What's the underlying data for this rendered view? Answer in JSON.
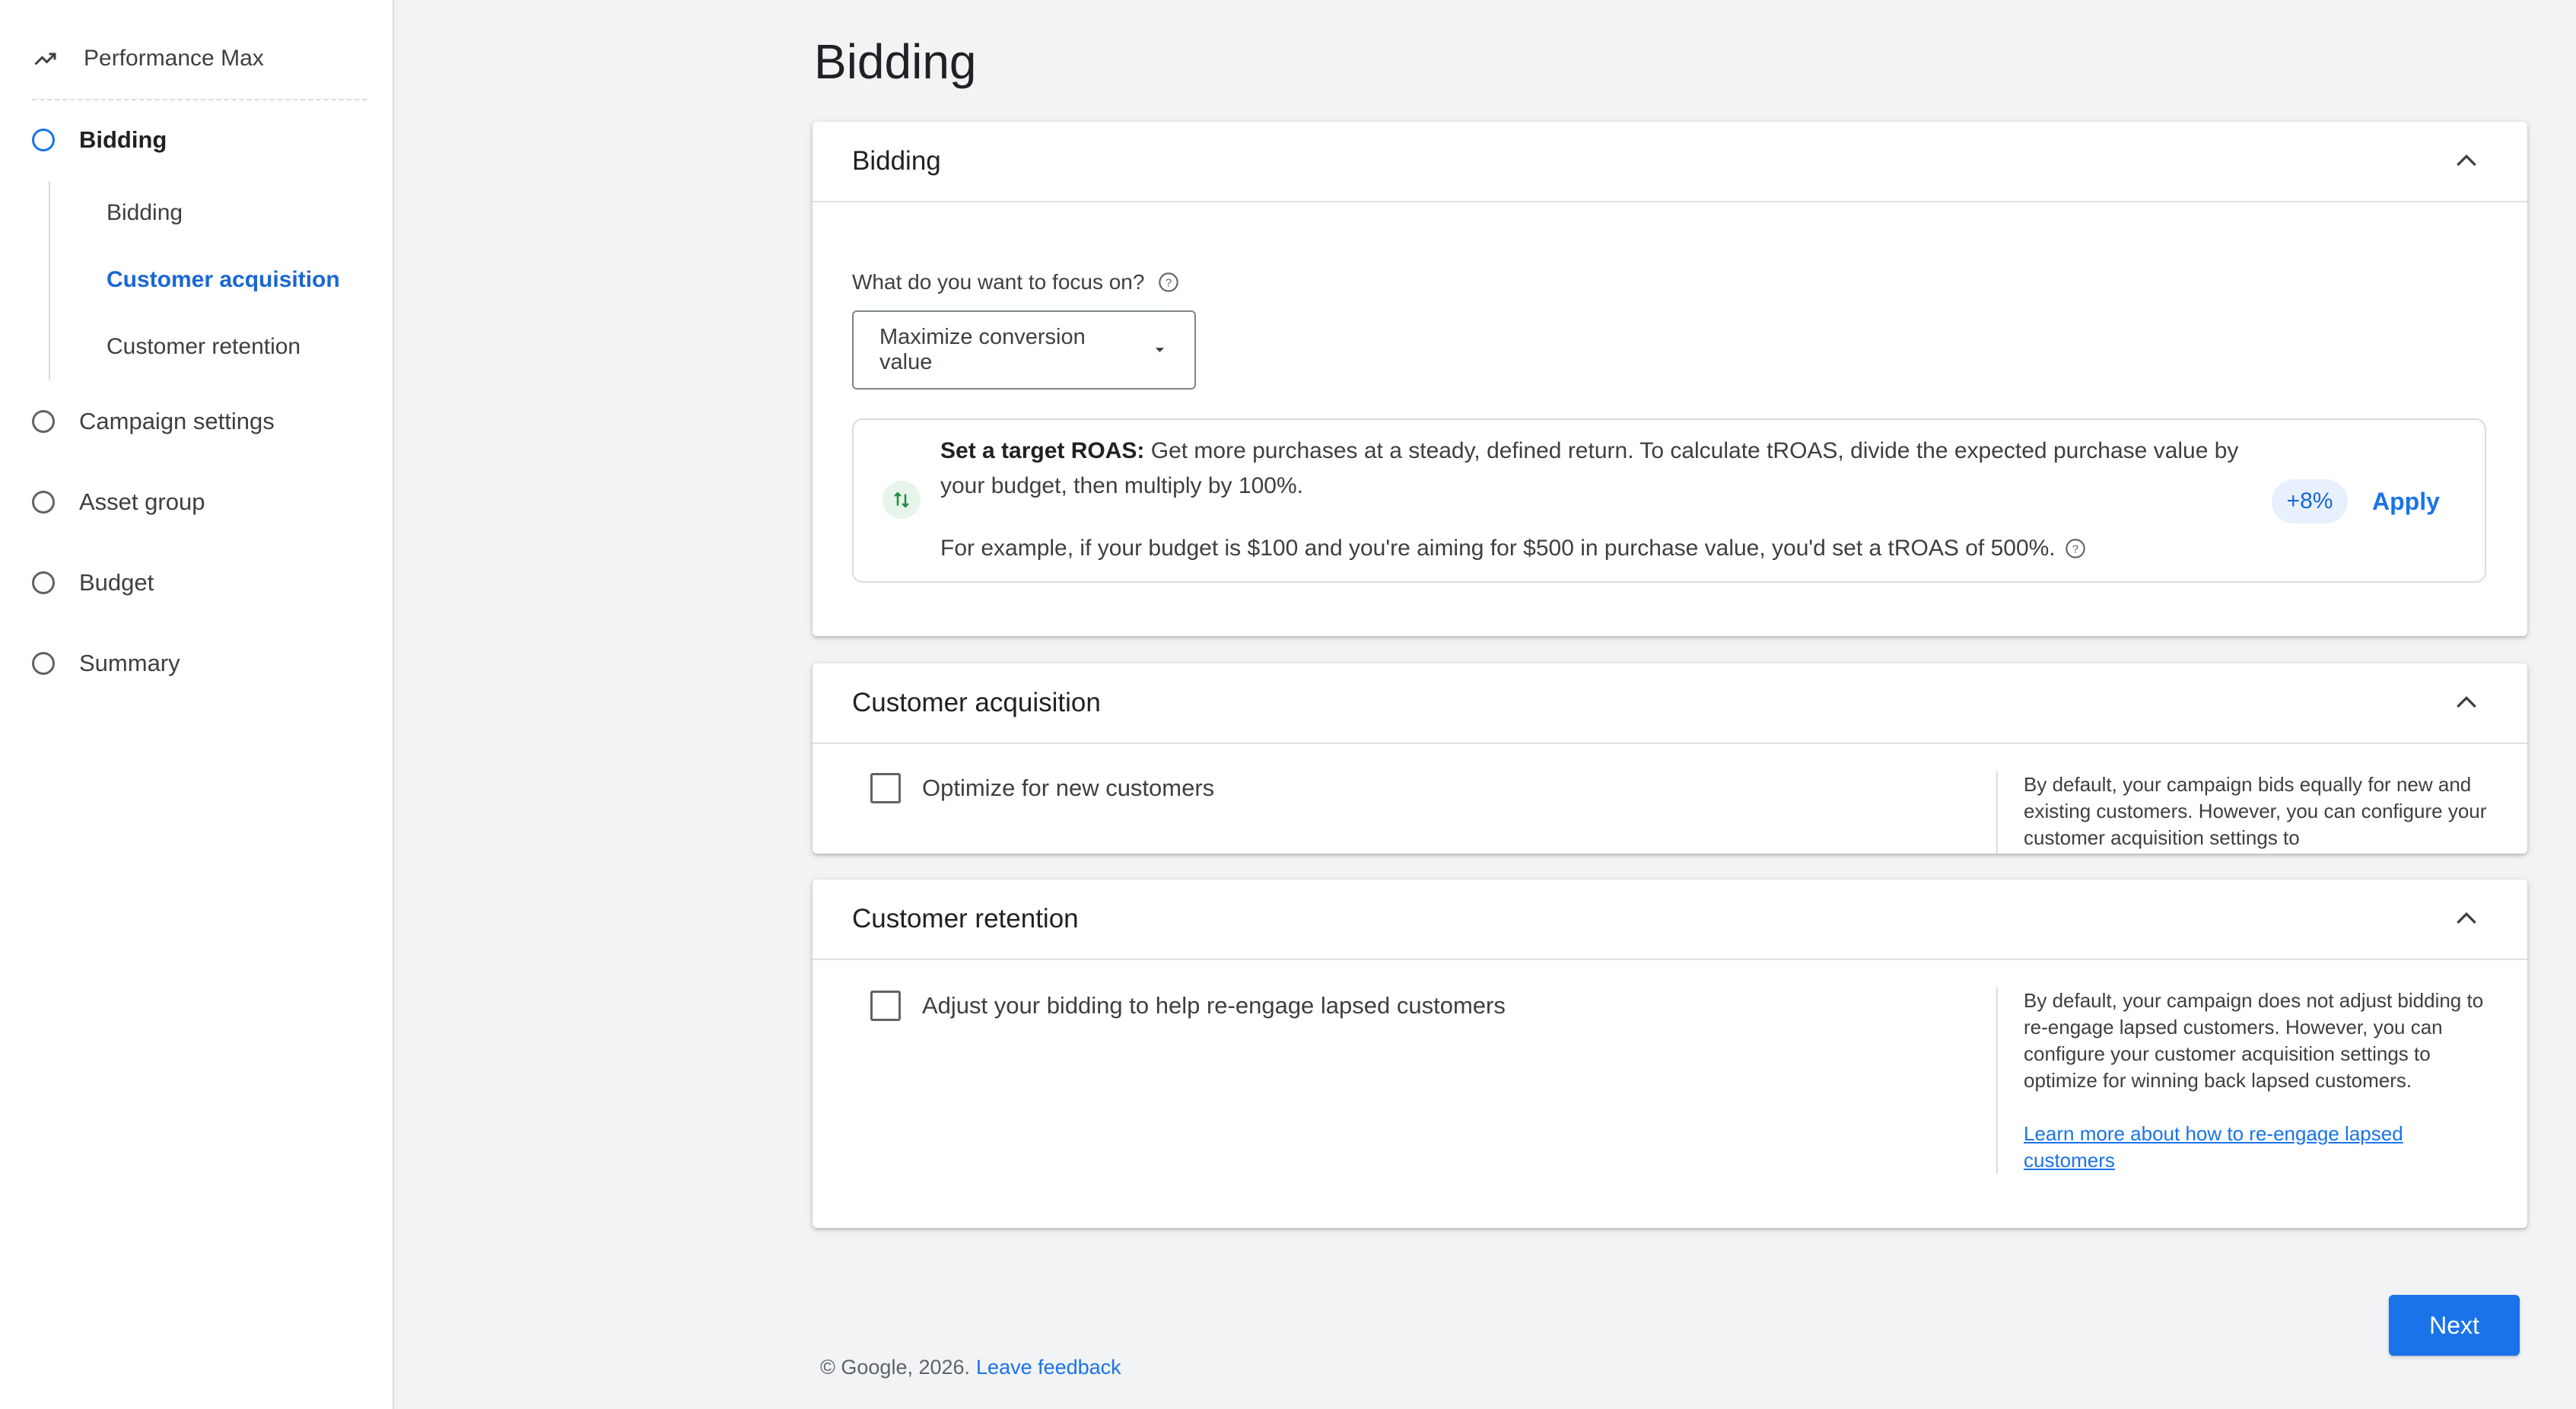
{
  "sidebar": {
    "campaign_type": "Performance Max",
    "steps": [
      {
        "label": "Bidding",
        "active": true
      },
      {
        "label": "Campaign settings",
        "active": false
      },
      {
        "label": "Asset group",
        "active": false
      },
      {
        "label": "Budget",
        "active": false
      },
      {
        "label": "Summary",
        "active": false
      }
    ],
    "sub_items": [
      {
        "label": "Bidding",
        "active": false
      },
      {
        "label": "Customer acquisition",
        "active": true
      },
      {
        "label": "Customer retention",
        "active": false
      }
    ]
  },
  "page": {
    "title": "Bidding"
  },
  "bidding_card": {
    "title": "Bidding",
    "focus_label": "What do you want to focus on?",
    "focus_value": "Maximize conversion value",
    "recommendation": {
      "heading": "Set a target ROAS:",
      "text": "Get more purchases at a steady, defined return. To calculate tROAS, divide the expected purchase value by your budget, then multiply by 100%.",
      "example": "For example, if your budget is $100 and you're aiming for $500 in purchase value, you'd set a tROAS of 500%.",
      "badge": "+8%",
      "apply_label": "Apply"
    }
  },
  "acquisition_card": {
    "title": "Customer acquisition",
    "option_label": "Optimize for new customers",
    "note": "By default, your campaign bids equally for new and existing customers. However, you can configure your customer acquisition settings to"
  },
  "retention_card": {
    "title": "Customer retention",
    "option_label": "Adjust your bidding to help re-engage lapsed customers",
    "note": "By default, your campaign does not adjust bidding to re-engage lapsed customers. However, you can configure your customer acquisition settings to optimize for winning back lapsed customers.",
    "link": "Learn more about how to re-engage lapsed customers"
  },
  "actions": {
    "next_label": "Next"
  },
  "footer": {
    "copyright": "© Google, 2026.",
    "feedback": "Leave feedback"
  },
  "colors": {
    "accent": "#1a73e8",
    "background": "#f1f3f4",
    "positive": "#1e8e3e"
  }
}
